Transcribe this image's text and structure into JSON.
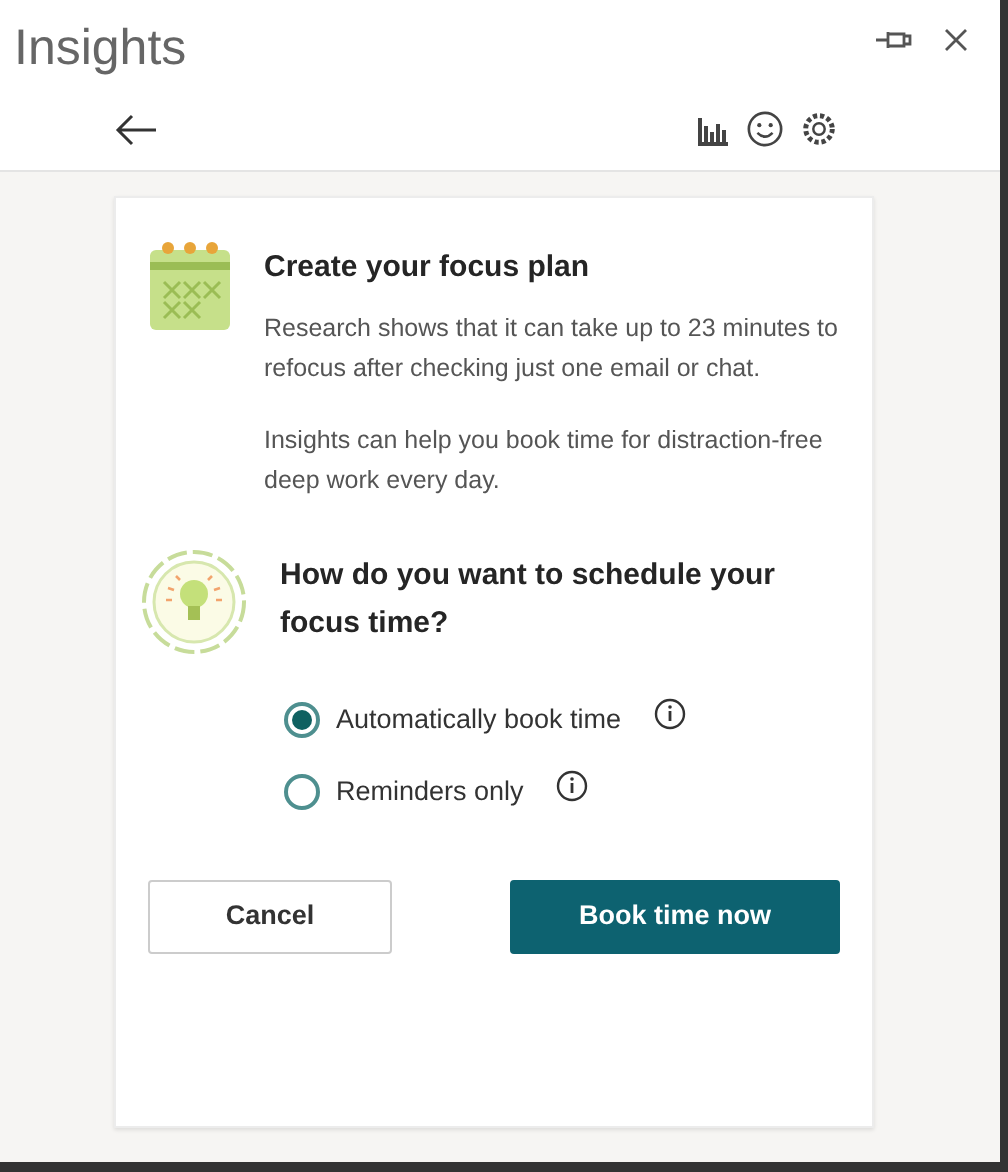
{
  "window": {
    "title": "Insights"
  },
  "card": {
    "title": "Create your focus plan",
    "paragraphs": [
      "Research shows that it can take up to 23 minutes to refocus after checking just one email or chat.",
      "Insights can help you book time for distraction-free deep work every day."
    ],
    "question": "How do you want to schedule your focus time?",
    "options": [
      {
        "label": "Automatically book time",
        "selected": true
      },
      {
        "label": "Reminders only",
        "selected": false
      }
    ],
    "buttons": [
      {
        "label": "Cancel",
        "kind": "secondary"
      },
      {
        "label": "Book time now",
        "kind": "primary"
      }
    ]
  }
}
